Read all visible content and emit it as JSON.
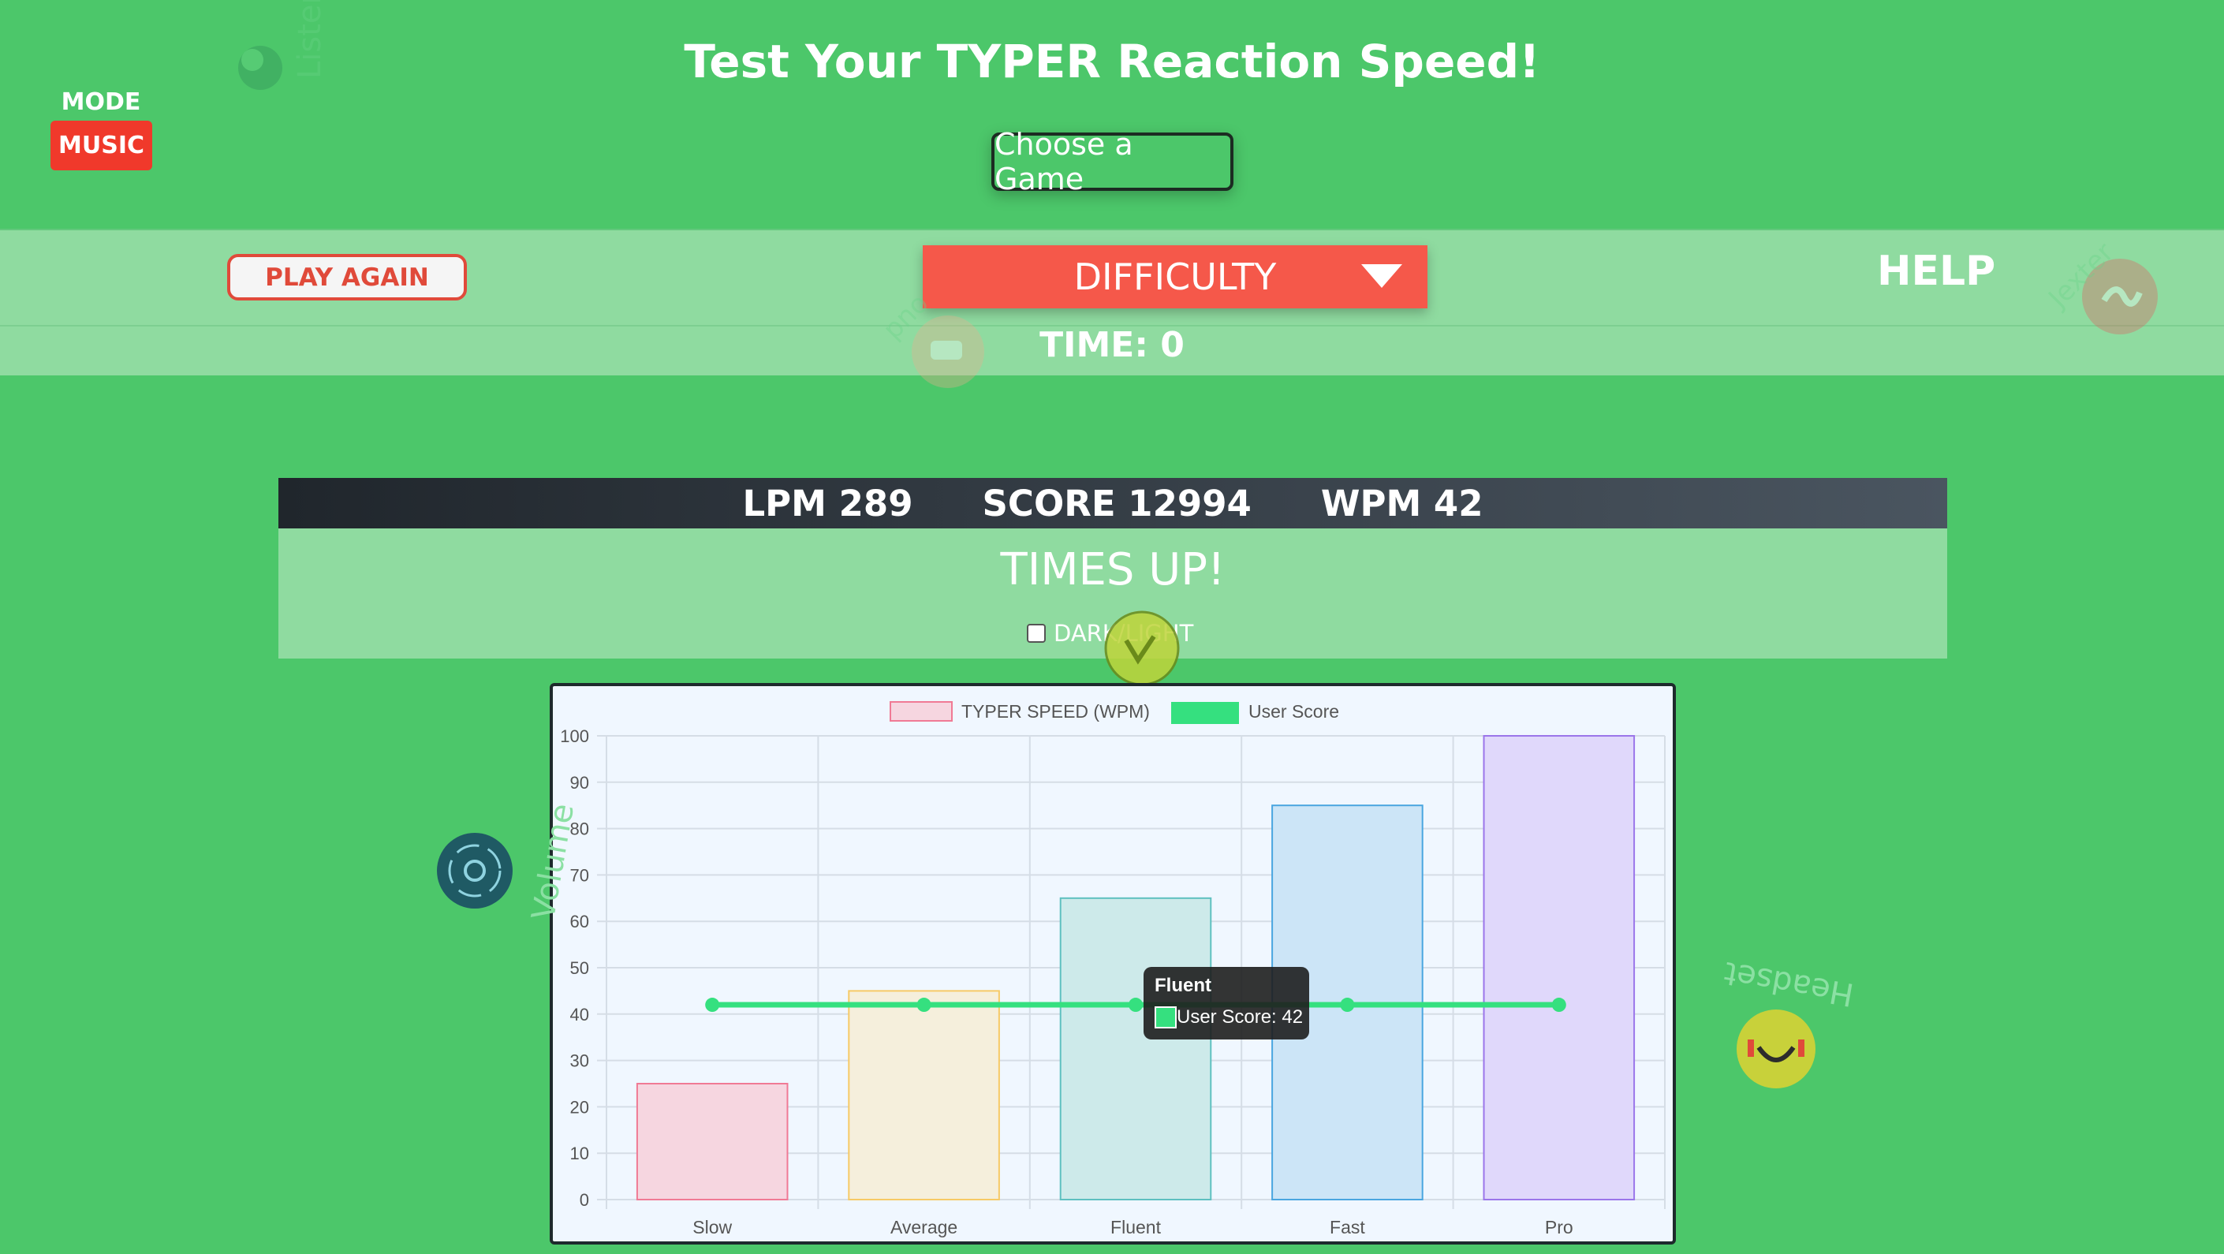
{
  "header": {
    "mode_label": "MODE",
    "music_label": "MUSIC",
    "title": "Test Your TYPER Reaction Speed!",
    "choose_game": "Choose a Game"
  },
  "controls": {
    "play_again": "PLAY AGAIN",
    "difficulty": "DIFFICULTY",
    "help": "HELP",
    "time": "TIME: 0"
  },
  "stats": {
    "lpm": "LPM 289",
    "score": "SCORE 12994",
    "wpm": "WPM 42"
  },
  "result": {
    "message": "TIMES UP!",
    "toggle_label": "DARK/LIGHT"
  },
  "floating_labels": {
    "listen": "Listen",
    "volume": "Volume",
    "headset": "Headset",
    "jexter": "Jexter",
    "pno": "pno"
  },
  "colors": {
    "background": "#4cc76a",
    "accent_red": "#f5584a",
    "user_score": "#35e07f"
  },
  "chart_data": {
    "type": "bar",
    "categories": [
      "Slow",
      "Average",
      "Fluent",
      "Fast",
      "Pro"
    ],
    "series": [
      {
        "name": "TYPER SPEED (WPM)",
        "type": "bar",
        "values": [
          25,
          45,
          65,
          85,
          100
        ],
        "fills": [
          "#f6d6e0",
          "#f5efdc",
          "#cdeaea",
          "#cce5f7",
          "#e0d8fb"
        ],
        "strokes": [
          "#f07a95",
          "#f7ca66",
          "#5ec0c0",
          "#4aa6e0",
          "#9b76ea"
        ]
      },
      {
        "name": "User Score",
        "type": "line",
        "values": [
          42,
          42,
          42,
          42,
          42
        ],
        "color": "#35e07f"
      }
    ],
    "legend_position": "top",
    "ylim": [
      0,
      100
    ],
    "yticks": [
      0,
      10,
      20,
      30,
      40,
      50,
      60,
      70,
      80,
      90,
      100
    ],
    "grid": true,
    "tooltip": {
      "title": "Fluent",
      "text": "User Score: 42"
    }
  }
}
